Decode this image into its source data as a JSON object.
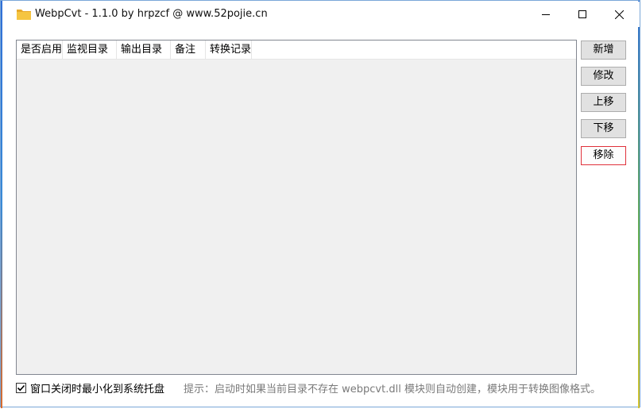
{
  "window": {
    "title": "WebpCvt - 1.1.0 by hrpzcf @ www.52pojie.cn",
    "icon": "folder-icon"
  },
  "table": {
    "columns": [
      "是否启用",
      "监视目录",
      "输出目录",
      "备注",
      "转换记录"
    ],
    "rows": []
  },
  "buttons": {
    "add": "新增",
    "edit": "修改",
    "move_up": "上移",
    "move_down": "下移",
    "remove": "移除"
  },
  "footer": {
    "minimize_to_tray_label": "窗口关闭时最小化到系统托盘",
    "minimize_to_tray_checked": true,
    "hint": "提示：启动时如果当前目录不存在 webpcvt.dll 模块则自动创建，模块用于转换图像格式。"
  },
  "colors": {
    "remove_border": "#e0313b",
    "folder_icon": "#f5c542"
  }
}
